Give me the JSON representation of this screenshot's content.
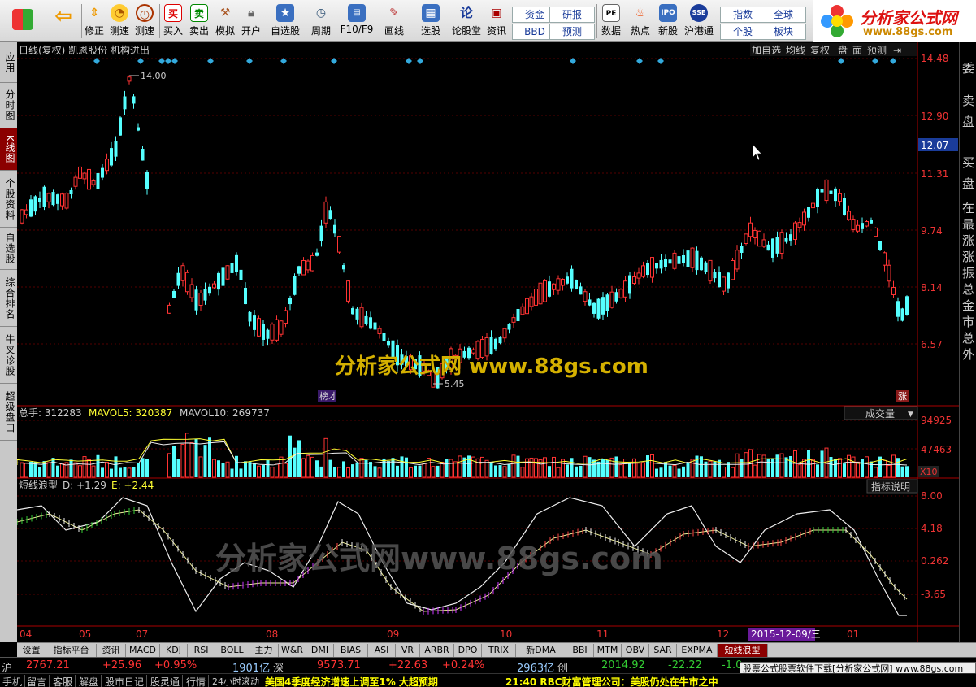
{
  "toolbar": {
    "buttons": [
      {
        "label": "",
        "icon": "grid-icon"
      },
      {
        "label": "",
        "icon": "back-arrow-icon"
      },
      {
        "label": "修正",
        "icon": "up-down-icon"
      },
      {
        "label": "测速",
        "icon": "speed-icon"
      },
      {
        "label": "测速",
        "icon": "clock-icon"
      },
      {
        "label": "买入",
        "icon": "buy-icon"
      },
      {
        "label": "卖出",
        "icon": "sell-icon"
      },
      {
        "label": "模拟",
        "icon": "hammer-icon"
      },
      {
        "label": "开户",
        "icon": "lock-icon"
      },
      {
        "label": "自选股",
        "icon": "star-icon"
      },
      {
        "label": "周期",
        "icon": "cycle-icon"
      },
      {
        "label": "F10/F9",
        "icon": "f10-icon"
      },
      {
        "label": "画线",
        "icon": "pen-icon"
      },
      {
        "label": "选股",
        "icon": "select-icon"
      },
      {
        "label": "论股堂",
        "icon": "forum-icon"
      },
      {
        "label": "资讯",
        "icon": "news-icon"
      },
      {
        "label": "数据",
        "icon": "pe-icon"
      },
      {
        "label": "热点",
        "icon": "hot-icon"
      },
      {
        "label": "新股",
        "icon": "ipo-icon"
      },
      {
        "label": "沪港通",
        "icon": "hk-icon"
      }
    ],
    "small_buttons": [
      "资金",
      "BBD",
      "研报",
      "预测",
      "指数",
      "个股",
      "全球",
      "板块"
    ]
  },
  "logo": {
    "title": "分析家公式网",
    "url": "www.88gs.com"
  },
  "left_tabs": [
    "应用",
    "分时图",
    "K线图",
    "个股资料",
    "自选股",
    "综合排名",
    "牛叉诊股",
    "超级盘口"
  ],
  "price_panel": {
    "header": "日线(复权) 凯恩股份 机构进出",
    "top_buttons": [
      "加自选",
      "均线",
      "复权",
      "盘",
      "面",
      "预测"
    ],
    "y_labels": [
      "14.48",
      "12.90",
      "11.31",
      "9.74",
      "8.14",
      "6.57"
    ],
    "current_price": "12.07",
    "high_label": "14.00",
    "low_label": "5.45",
    "badge_left": "榜才",
    "badge_right": "涨"
  },
  "volume_panel": {
    "total": "总手: 312283",
    "mavol5": "MAVOL5: 320387",
    "mavol10": "MAVOL10: 269737",
    "select": "成交量",
    "y_labels": [
      "94925",
      "47463"
    ],
    "unit": "X10"
  },
  "indicator_panel": {
    "name": "短线浪型",
    "d": "D: +1.29",
    "e": "E: +2.44",
    "help": "指标说明",
    "y_labels": [
      "8.00",
      "4.18",
      "0.262",
      "-3.65"
    ]
  },
  "x_axis": {
    "months": [
      "04",
      "05",
      "07",
      "08",
      "09",
      "10",
      "11",
      "12",
      "01"
    ],
    "cursor_date": "2015-12-09/三"
  },
  "tabs": [
    "设置",
    "指标平台",
    "资讯",
    "MACD",
    "KDJ",
    "RSI",
    "BOLL",
    "主力",
    "W&R",
    "DMI",
    "BIAS",
    "ASI",
    "VR",
    "ARBR",
    "DPO",
    "TRIX",
    "新DMA",
    "BBI",
    "MTM",
    "OBV",
    "SAR",
    "EXPMA",
    "短线浪型"
  ],
  "market": {
    "sh_label": "沪",
    "sh_index": "2767.21",
    "sh_change": "+25.96",
    "sh_pct": "+0.95%",
    "sh_amount": "1901亿",
    "sz_label": "深",
    "sz_index": "9573.71",
    "sz_change": "+22.63",
    "sz_pct": "+0.24%",
    "sz_amount": "2963亿",
    "cy_label": "创",
    "cy_index": "2014.92",
    "cy_change": "-22.22",
    "cy_pct": "-1.0"
  },
  "status": {
    "buttons": [
      "手机",
      "留言",
      "客服",
      "解盘",
      "股市日记",
      "股灵通",
      "行情",
      "24小时滚动"
    ],
    "news1": "美国4季度经济增速上调至1% 大超预期",
    "news2": "21:40 RBC财富管理公司：美股仍处在牛市之中"
  },
  "footer_ad": "股票公式股票软件下载[分析家公式网] www.88gs.com",
  "watermark": {
    "text1": "分析家公式网 www.88gs.com",
    "text2": "分析家公式网www.88gs.com"
  },
  "right_panel": [
    "委",
    "卖",
    "盘",
    "买",
    "盘",
    "在",
    "最",
    "涨",
    "涨",
    "振",
    "总",
    "金",
    "市",
    "总",
    "外"
  ]
}
